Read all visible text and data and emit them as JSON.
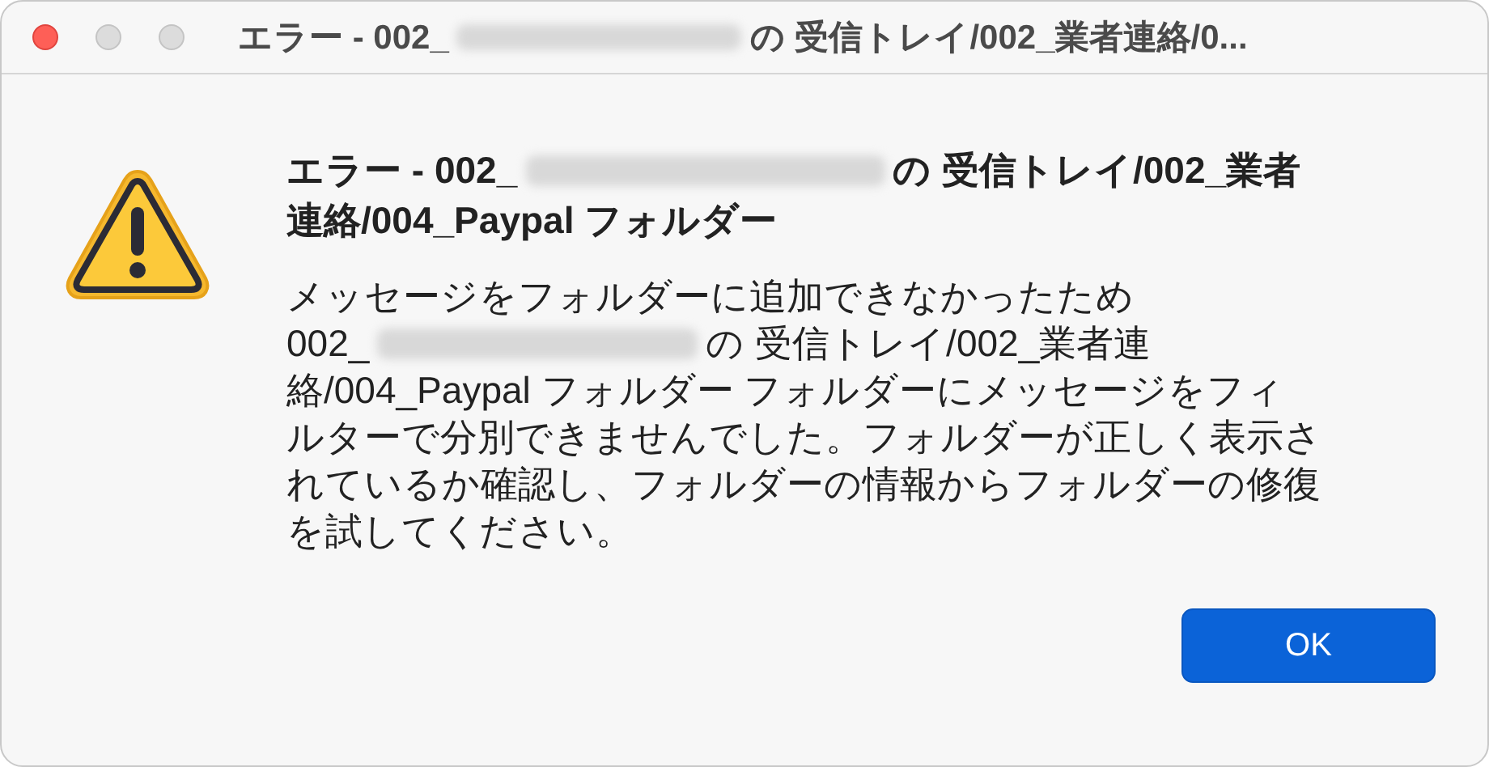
{
  "window": {
    "title": [
      {
        "kind": "text",
        "text": "エラー - 002_"
      },
      {
        "kind": "redacted"
      },
      {
        "kind": "text",
        "text": "の 受信トレイ/002_業者連絡/0..."
      }
    ],
    "controls": [
      {
        "kind": "close"
      },
      {
        "kind": "minimize"
      },
      {
        "kind": "zoom"
      }
    ]
  },
  "alert": {
    "heading_lines": [
      [
        {
          "kind": "text",
          "text": "エラー - 002_"
        },
        {
          "kind": "redacted"
        },
        {
          "kind": "text",
          "text": "の 受信トレイ/002_業者"
        }
      ],
      [
        {
          "kind": "text",
          "text": "連絡/004_Paypal フォルダー"
        }
      ]
    ],
    "message_lines": [
      [
        {
          "kind": "text",
          "text": "メッセージをフォルダーに追加できなかったため"
        }
      ],
      [
        {
          "kind": "text",
          "text": "002_"
        },
        {
          "kind": "redacted"
        },
        {
          "kind": "text",
          "text": "の 受信トレイ/002_業者連"
        }
      ],
      [
        {
          "kind": "text",
          "text": "絡/004_Paypal フォルダー フォルダーにメッセージをフィ"
        }
      ],
      [
        {
          "kind": "text",
          "text": "ルターで分別できませんでした。フォルダーが正しく表示さ"
        }
      ],
      [
        {
          "kind": "text",
          "text": "れているか確認し、フォルダーの情報からフォルダーの修復"
        }
      ],
      [
        {
          "kind": "text",
          "text": "を試してください。"
        }
      ]
    ],
    "buttons": [
      {
        "label": "OK",
        "default": true
      }
    ]
  }
}
